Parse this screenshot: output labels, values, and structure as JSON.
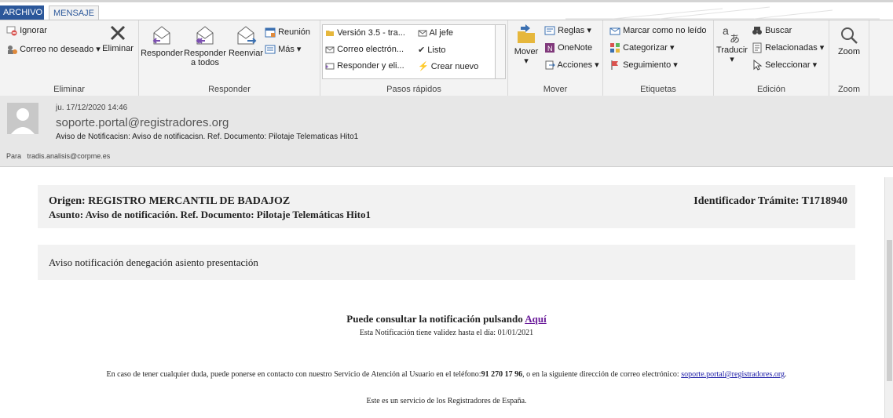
{
  "tabs": {
    "archivo": "ARCHIVO",
    "mensaje": "MENSAJE"
  },
  "ribbon": {
    "eliminar": {
      "ignorar": "Ignorar",
      "correo_no_deseado": "Correo no deseado",
      "eliminar_btn": "Eliminar",
      "label": "Eliminar"
    },
    "responder": {
      "responder": "Responder",
      "responder_todos_1": "Responder",
      "responder_todos_2": "a todos",
      "reenviar": "Reenviar",
      "reunion": "Reunión",
      "mas": "Más",
      "label": "Responder"
    },
    "pasos_rapidos": {
      "items": [
        "Versión 3.5 - tra...",
        "Al jefe",
        "Correo electrón...",
        "Listo",
        "Responder y eli...",
        "Crear nuevo"
      ],
      "label": "Pasos rápidos"
    },
    "mover": {
      "mover": "Mover",
      "reglas": "Reglas",
      "onenote": "OneNote",
      "acciones": "Acciones",
      "label": "Mover"
    },
    "etiquetas": {
      "marcar": "Marcar como no leído",
      "categorizar": "Categorizar",
      "seguimiento": "Seguimiento",
      "label": "Etiquetas"
    },
    "edicion": {
      "traducir": "Traducir",
      "buscar": "Buscar",
      "relacionadas": "Relacionadas",
      "seleccionar": "Seleccionar",
      "label": "Edición"
    },
    "zoom": {
      "zoom": "Zoom",
      "label": "Zoom"
    }
  },
  "message_header": {
    "date": "ju. 17/12/2020 14:46",
    "from": "soporte.portal@registradores.org",
    "subject": "Aviso de Notificacisn: Aviso de notificacisn. Ref. Documento: Pilotaje Telematicas Hito1",
    "to_label": "Para",
    "to": "tradis.analisis@corpme.es"
  },
  "body": {
    "origen": "Origen: REGISTRO MERCANTIL DE BADAJOZ",
    "asunto": "Asunto: Aviso de notificación. Ref. Documento: Pilotaje Telemáticas Hito1",
    "identificador": "Identificador Trámite: T1718940",
    "aviso": "Aviso notificación denegación asiento presentación",
    "consultar_text": "Puede consultar la notificación pulsando ",
    "consultar_link": "Aquí",
    "validez": "Esta Notificación tiene validez hasta el día: 01/01/2021",
    "contacto_pre": "En caso de tener cualquier duda, puede ponerse en contacto con nuestro Servicio de Atención al Usuario en el teléfono:",
    "telefono": "91 270 17 96",
    "contacto_mid": ", o en la siguiente dirección de correo electrónico: ",
    "email": "soporte.portal@registradores.org",
    "contacto_end": ".",
    "servicio": "Este es un servicio de los Registradores de España."
  },
  "colors": {
    "accent": "#2b579a",
    "link_visited": "#6a1b9a",
    "link": "#1a1aa6"
  }
}
